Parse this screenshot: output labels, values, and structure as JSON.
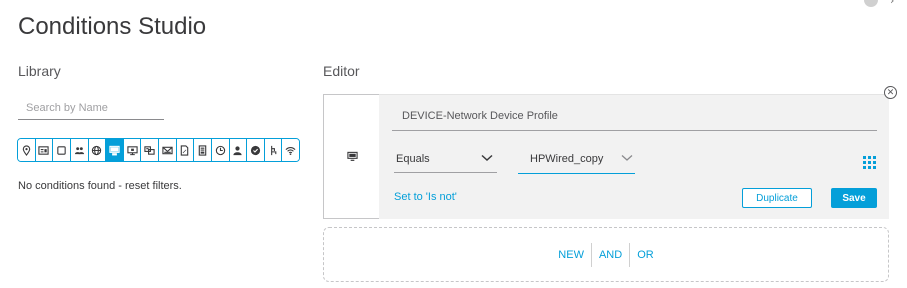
{
  "title": "Conditions Studio",
  "library": {
    "label": "Library",
    "search_placeholder": "Search by Name",
    "filters": [
      {
        "icon": "location-pin-icon",
        "active": false
      },
      {
        "icon": "id-card-icon",
        "active": false
      },
      {
        "icon": "square-icon",
        "active": false
      },
      {
        "icon": "user-group-icon",
        "active": false
      },
      {
        "icon": "globe-icon",
        "active": false
      },
      {
        "icon": "monitor-icon",
        "active": true
      },
      {
        "icon": "screen-icon",
        "active": false
      },
      {
        "icon": "device-card-icon",
        "active": false
      },
      {
        "icon": "envelope-icon",
        "active": false
      },
      {
        "icon": "document-edit-icon",
        "active": false
      },
      {
        "icon": "document-list-icon",
        "active": false
      },
      {
        "icon": "clock-icon",
        "active": false
      },
      {
        "icon": "user-icon",
        "active": false
      },
      {
        "icon": "check-badge-icon",
        "active": false
      },
      {
        "icon": "network-tree-icon",
        "active": false
      },
      {
        "icon": "wifi-icon",
        "active": false
      }
    ],
    "empty_message": "No conditions found - reset filters."
  },
  "editor": {
    "label": "Editor",
    "condition": {
      "icon": "monitor-icon",
      "attribute": "DEVICE-Network Device Profile",
      "operator": "Equals",
      "value": "HPWired_copy",
      "set_not_label": "Set to 'Is not'",
      "duplicate_label": "Duplicate",
      "save_label": "Save"
    },
    "new_ops": [
      "NEW",
      "AND",
      "OR"
    ]
  },
  "colors": {
    "accent": "#049fd9",
    "text": "#39393b",
    "panel_bg": "#f2f2f2"
  }
}
